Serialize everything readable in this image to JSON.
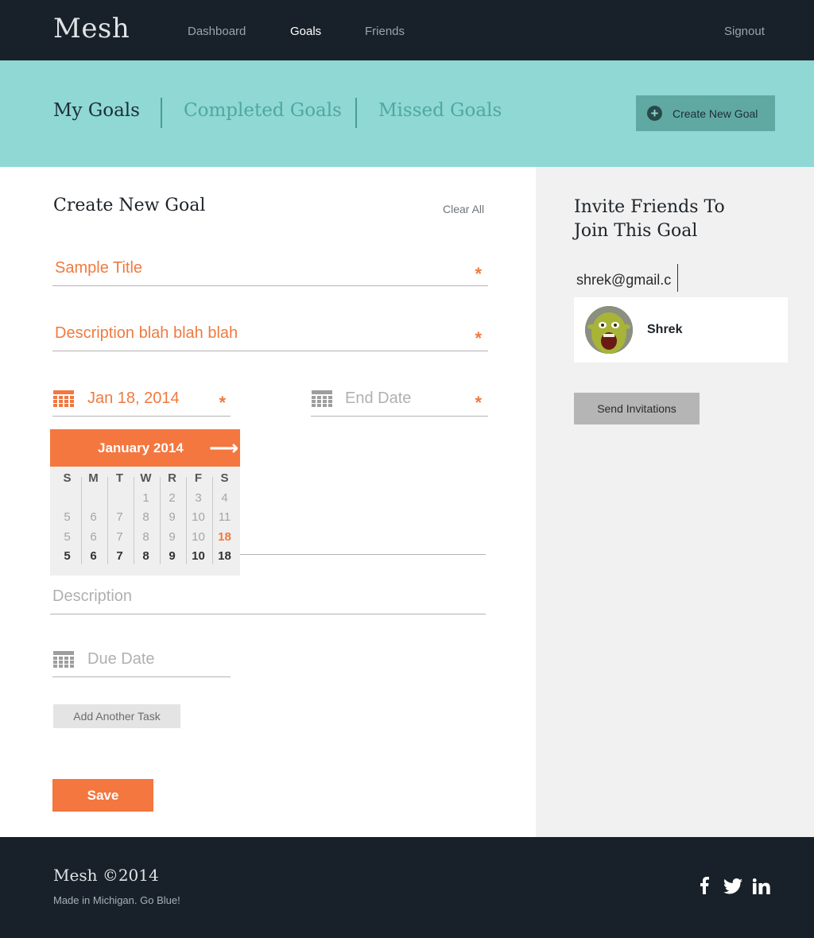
{
  "brand": "Mesh",
  "nav": {
    "items": [
      {
        "label": "Dashboard",
        "active": false
      },
      {
        "label": "Goals",
        "active": true
      },
      {
        "label": "Friends",
        "active": false
      }
    ],
    "signout": "Signout"
  },
  "tabs": [
    {
      "label": "My Goals",
      "active": true
    },
    {
      "label": "Completed Goals",
      "active": false
    },
    {
      "label": "Missed Goals",
      "active": false
    }
  ],
  "create_button": {
    "icon": "plus-circle-icon",
    "label": "Create New Goal"
  },
  "form": {
    "heading": "Create New Goal",
    "clear_all": "Clear All",
    "title_value": "Sample Title",
    "description_value": "Description blah blah blah",
    "start_date_value": "Jan 18, 2014",
    "end_date_placeholder": "End Date",
    "required_marker": "*",
    "task_description_placeholder": "Description",
    "due_date_placeholder": "Due Date",
    "add_task_label": "Add Another Task",
    "save_label": "Save"
  },
  "calendar": {
    "month_label": "January 2014",
    "next_icon": "arrow-right-icon",
    "columns": [
      {
        "head": "S",
        "days": [
          "",
          "5",
          "5",
          "5"
        ]
      },
      {
        "head": "M",
        "days": [
          "",
          "6",
          "6",
          "6"
        ]
      },
      {
        "head": "T",
        "days": [
          "",
          "7",
          "7",
          "7"
        ]
      },
      {
        "head": "W",
        "days": [
          "1",
          "8",
          "8",
          "8"
        ]
      },
      {
        "head": "R",
        "days": [
          "2",
          "9",
          "9",
          "9"
        ]
      },
      {
        "head": "F",
        "days": [
          "3",
          "10",
          "10",
          "10"
        ]
      },
      {
        "head": "S",
        "days": [
          "4",
          "11",
          "18",
          "18"
        ]
      }
    ],
    "selected_day": "18"
  },
  "invite": {
    "title_line1": "Invite Friends To",
    "title_line2": "Join This Goal",
    "email_value": "shrek@gmail.c",
    "friend_name": "Shrek",
    "send_label": "Send Invitations"
  },
  "footer": {
    "brand": "Mesh ©2014",
    "tagline": "Made in Michigan. Go Blue!",
    "social": [
      "facebook-icon",
      "twitter-icon",
      "linkedin-icon"
    ]
  },
  "colors": {
    "accent": "#f3773f",
    "teal": "#8fd8d3",
    "dark": "#182129"
  }
}
